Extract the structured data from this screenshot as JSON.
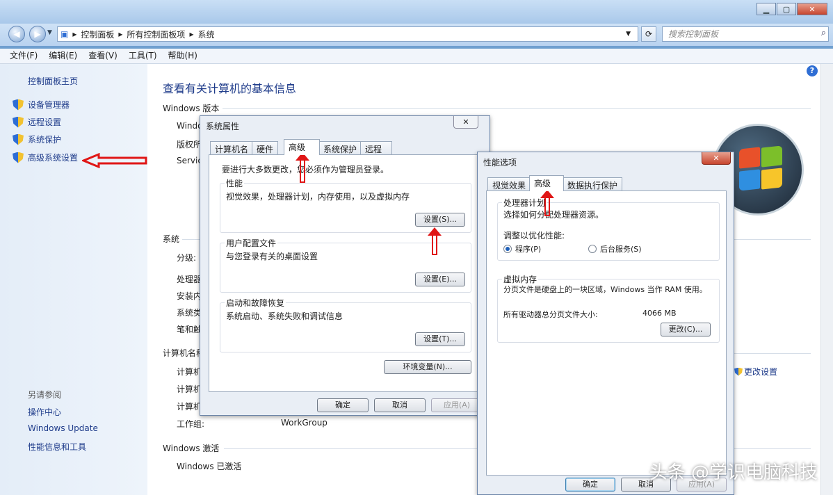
{
  "window": {
    "minimize_icon": "minimize-icon",
    "maximize_icon": "maximize-icon",
    "close_icon": "close-icon"
  },
  "address": {
    "path": [
      "控制面板",
      "所有控制面板项",
      "系统"
    ],
    "search_placeholder": "搜索控制面板"
  },
  "menu": [
    "文件(F)",
    "编辑(E)",
    "查看(V)",
    "工具(T)",
    "帮助(H)"
  ],
  "sidebar": {
    "home": "控制面板主页",
    "items": [
      "设备管理器",
      "远程设置",
      "系统保护",
      "高级系统设置"
    ],
    "see_also": "另请参阅",
    "links": [
      "操作中心",
      "Windows Update",
      "性能信息和工具"
    ]
  },
  "main": {
    "title": "查看有关计算机的基本信息",
    "sections": {
      "edition": "Windows 版本",
      "system": "系统",
      "computer": "计算机名称",
      "activation": "Windows 激活"
    },
    "partial_labels": {
      "win": "Windo",
      "copyright": "版权所",
      "service": "Servic",
      "rating": "分级:",
      "cpu": "处理器",
      "ram": "安装内",
      "type": "系统类",
      "pen": "笔和触",
      "cn1": "计算机",
      "cn2": "计算机",
      "cn3": "计算机",
      "activated": "Windows 已激活"
    },
    "workgroup_label": "工作组:",
    "workgroup_value": "WorkGroup",
    "change_settings": "更改设置"
  },
  "sysprops": {
    "title": "系统属性",
    "tabs": [
      "计算机名",
      "硬件",
      "高级",
      "系统保护",
      "远程"
    ],
    "admin_note": "要进行大多数更改，您必须作为管理员登录。",
    "perf": {
      "label": "性能",
      "desc": "视觉效果，处理器计划，内存使用，以及虚拟内存",
      "btn": "设置(S)..."
    },
    "profile": {
      "label": "用户配置文件",
      "desc": "与您登录有关的桌面设置",
      "btn": "设置(E)..."
    },
    "startup": {
      "label": "启动和故障恢复",
      "desc": "系统启动、系统失败和调试信息",
      "btn": "设置(T)..."
    },
    "env_btn": "环境变量(N)...",
    "ok": "确定",
    "cancel": "取消",
    "apply": "应用(A)"
  },
  "perfopts": {
    "title": "性能选项",
    "tabs": [
      "视觉效果",
      "高级",
      "数据执行保护"
    ],
    "sched": {
      "label": "处理器计划",
      "desc": "选择如何分配处理器资源。",
      "adjust": "调整以优化性能:",
      "opt1": "程序(P)",
      "opt2": "后台服务(S)"
    },
    "vm": {
      "label": "虚拟内存",
      "desc": "分页文件是硬盘上的一块区域，Windows 当作 RAM 使用。",
      "total_label": "所有驱动器总分页文件大小:",
      "total_value": "4066 MB",
      "btn": "更改(C)..."
    },
    "ok": "确定",
    "cancel": "取消",
    "apply": "应用(A)"
  },
  "watermark": "头条 @学识电脑科技"
}
